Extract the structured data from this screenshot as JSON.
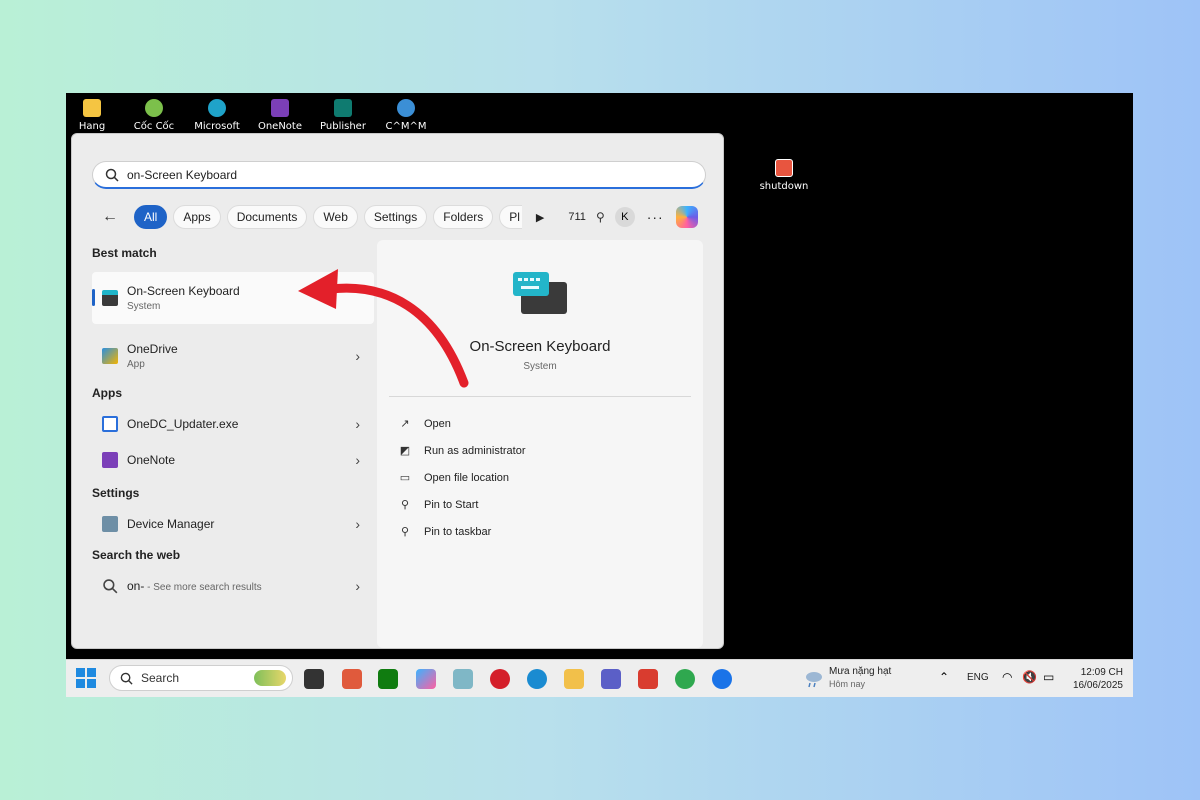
{
  "desktop": {
    "icons": [
      {
        "label": "Hang",
        "color": "#f5c542"
      },
      {
        "label": "Cốc Cốc",
        "color": "#7cc04b"
      },
      {
        "label": "Microsoft",
        "color": "#1fa3c9"
      },
      {
        "label": "OneNote",
        "color": "#7b3fb8"
      },
      {
        "label": "Publisher",
        "color": "#0f7b70"
      },
      {
        "label": "C^M^M",
        "color": "#3b8fd6"
      }
    ],
    "shutdown_label": "shutdown"
  },
  "search": {
    "query": "on-Screen Keyboard",
    "icon": "search-icon"
  },
  "filters": {
    "back_icon": "back-arrow-icon",
    "chips": [
      "All",
      "Apps",
      "Documents",
      "Web",
      "Settings",
      "Folders",
      "Pl"
    ],
    "play_icon": "▶",
    "count": "711",
    "account_initial": "K",
    "more": "···"
  },
  "results": {
    "best_match_heading": "Best match",
    "best_match": {
      "title": "On-Screen Keyboard",
      "sub": "System"
    },
    "onedrive": {
      "title": "OneDrive",
      "sub": "App"
    },
    "apps_heading": "Apps",
    "apps": [
      {
        "title": "OneDC_Updater.exe"
      },
      {
        "title": "OneNote"
      }
    ],
    "settings_heading": "Settings",
    "settings": [
      {
        "title": "Device Manager"
      }
    ],
    "web_heading": "Search the web",
    "web_query": "on-",
    "web_more": " - See more search results"
  },
  "detail": {
    "title": "On-Screen Keyboard",
    "sub": "System",
    "actions": [
      {
        "label": "Open",
        "icon": "↗"
      },
      {
        "label": "Run as administrator",
        "icon": "◩"
      },
      {
        "label": "Open file location",
        "icon": "▭"
      },
      {
        "label": "Pin to Start",
        "icon": "⚲"
      },
      {
        "label": "Pin to taskbar",
        "icon": "⚲"
      }
    ]
  },
  "taskbar": {
    "search_label": "Search",
    "apps": [
      {
        "name": "task-view",
        "color": "#333333"
      },
      {
        "name": "app-red",
        "color": "#e05a3c"
      },
      {
        "name": "xbox",
        "color": "#107c10"
      },
      {
        "name": "copilot",
        "color": "#8a5cf6"
      },
      {
        "name": "app-teal",
        "color": "#7fb7c6"
      },
      {
        "name": "opera",
        "color": "#d41f2a"
      },
      {
        "name": "edge",
        "color": "#1a8bd1"
      },
      {
        "name": "explorer",
        "color": "#f2c04a"
      },
      {
        "name": "teams",
        "color": "#5b5fc7"
      },
      {
        "name": "wps",
        "color": "#d93c2f"
      },
      {
        "name": "coccoc",
        "color": "#2fa84f"
      },
      {
        "name": "zalo",
        "color": "#1a73e8"
      }
    ],
    "weather_line1": "Mưa nặng hạt",
    "weather_line2": "Hôm nay",
    "language": "ENG",
    "time": "12:09 CH",
    "date": "16/06/2025"
  },
  "colors": {
    "accent": "#1e63c7",
    "arrow": "#e3202a"
  }
}
